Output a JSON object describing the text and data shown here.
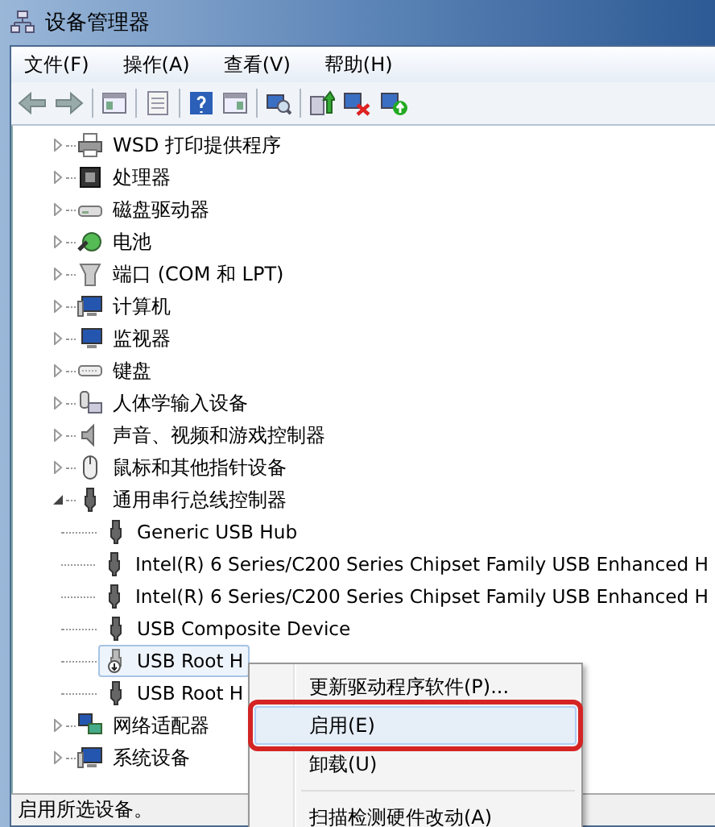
{
  "window": {
    "title": "设备管理器"
  },
  "menu_bar": [
    "文件(F)",
    "操作(A)",
    "查看(V)",
    "帮助(H)"
  ],
  "tree": [
    {
      "label": "WSD 打印提供程序",
      "expanded": false
    },
    {
      "label": "处理器",
      "expanded": false
    },
    {
      "label": "磁盘驱动器",
      "expanded": false
    },
    {
      "label": "电池",
      "expanded": false
    },
    {
      "label": "端口 (COM 和 LPT)",
      "expanded": false
    },
    {
      "label": "计算机",
      "expanded": false
    },
    {
      "label": "监视器",
      "expanded": false
    },
    {
      "label": "键盘",
      "expanded": false
    },
    {
      "label": "人体学输入设备",
      "expanded": false
    },
    {
      "label": "声音、视频和游戏控制器",
      "expanded": false
    },
    {
      "label": "鼠标和其他指针设备",
      "expanded": false
    },
    {
      "label": "通用串行总线控制器",
      "expanded": true,
      "children": [
        {
          "label": "Generic USB Hub",
          "selected": false,
          "disabled": false
        },
        {
          "label": "Intel(R) 6 Series/C200 Series Chipset Family USB Enhanced H",
          "selected": false,
          "disabled": false
        },
        {
          "label": "Intel(R) 6 Series/C200 Series Chipset Family USB Enhanced H",
          "selected": false,
          "disabled": false
        },
        {
          "label": "USB Composite Device",
          "selected": false,
          "disabled": false
        },
        {
          "label": "USB Root H",
          "selected": true,
          "disabled": true
        },
        {
          "label": "USB Root H",
          "selected": false,
          "disabled": false
        }
      ]
    },
    {
      "label": "网络适配器",
      "expanded": false
    },
    {
      "label": "系统设备",
      "expanded": false
    }
  ],
  "context_menu": [
    {
      "label": "更新驱动程序软件(P)...",
      "selected": false,
      "outlined": false
    },
    {
      "label": "启用(E)",
      "selected": true,
      "outlined": true
    },
    {
      "label": "卸载(U)",
      "selected": false,
      "outlined": false
    },
    {
      "label": "扫描检测硬件改动(A)",
      "selected": false,
      "outlined": false,
      "separator_before": true
    }
  ],
  "status_bar": "启用所选设备。"
}
